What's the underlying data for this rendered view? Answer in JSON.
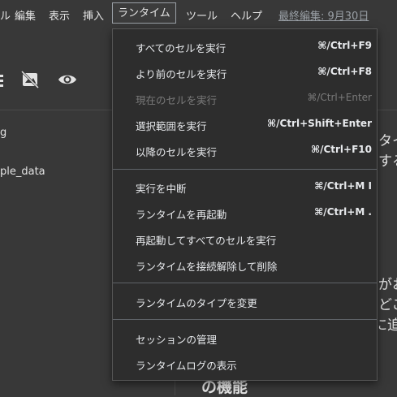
{
  "menubar": {
    "items": [
      "ル",
      "編集",
      "表示",
      "挿入",
      "ランタイム",
      "ツール",
      "ヘルプ"
    ],
    "last_edited": "最終編集: 9月30日"
  },
  "left_panel": {
    "item1": "g",
    "item2": "ple_data"
  },
  "right_content": {
    "line1": "タイ",
    "line2": "する",
    "line3": "がお",
    "line4": "どこ",
    "line5": "に追加",
    "heading": "の機能"
  },
  "runtime_menu": {
    "groups": [
      [
        {
          "label": "すべてのセルを実行",
          "shortcut": "⌘/Ctrl+F9",
          "enabled": true
        },
        {
          "label": "より前のセルを実行",
          "shortcut": "⌘/Ctrl+F8",
          "enabled": true
        },
        {
          "label": "現在のセルを実行",
          "shortcut": "⌘/Ctrl+Enter",
          "enabled": false
        },
        {
          "label": "選択範囲を実行",
          "shortcut": "⌘/Ctrl+Shift+Enter",
          "enabled": true
        },
        {
          "label": "以降のセルを実行",
          "shortcut": "⌘/Ctrl+F10",
          "enabled": true
        }
      ],
      [
        {
          "label": "実行を中断",
          "shortcut": "⌘/Ctrl+M I",
          "enabled": true
        },
        {
          "label": "ランタイムを再起動",
          "shortcut": "⌘/Ctrl+M .",
          "enabled": true
        },
        {
          "label": "再起動してすべてのセルを実行",
          "shortcut": "",
          "enabled": true
        },
        {
          "label": "ランタイムを接続解除して削除",
          "shortcut": "",
          "enabled": true
        }
      ],
      [
        {
          "label": "ランタイムのタイプを変更",
          "shortcut": "",
          "enabled": true
        }
      ],
      [
        {
          "label": "セッションの管理",
          "shortcut": "",
          "enabled": true
        },
        {
          "label": "ランタイムログの表示",
          "shortcut": "",
          "enabled": true
        }
      ]
    ]
  }
}
